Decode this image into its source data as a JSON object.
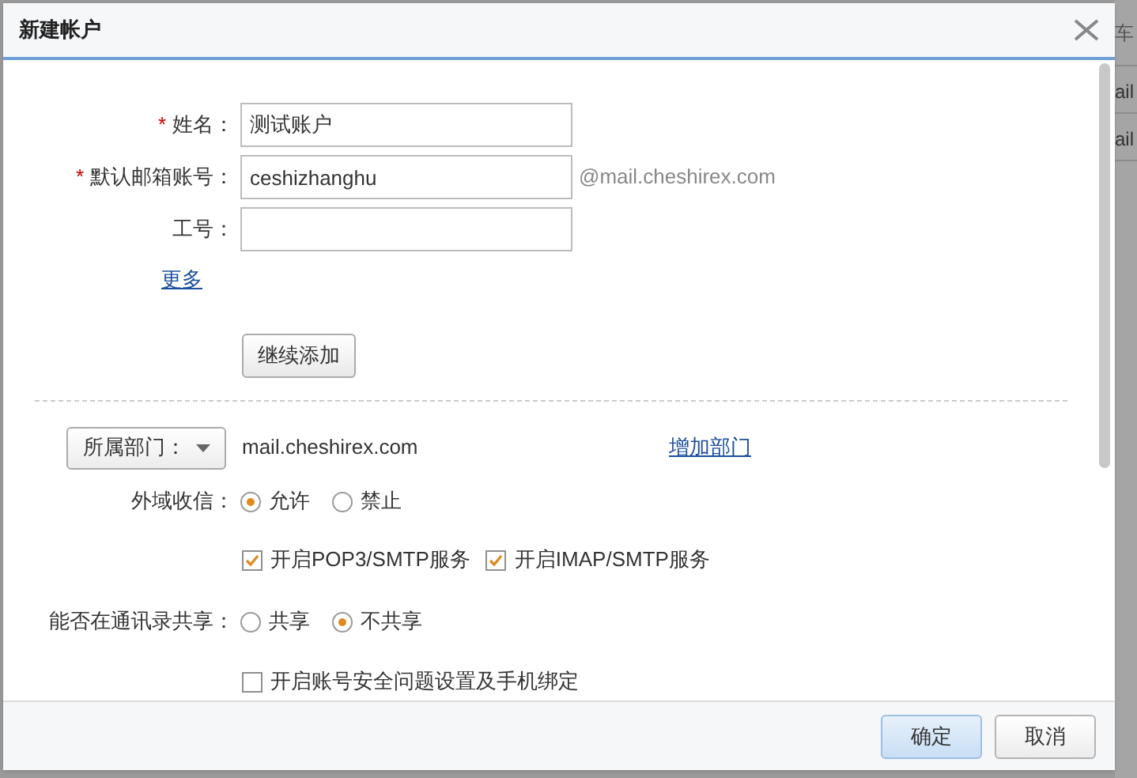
{
  "background": {
    "header_fragment": "车",
    "row_fragments": [
      "ail",
      "ail"
    ]
  },
  "dialog": {
    "title": "新建帐户",
    "fields": [
      {
        "label": "姓名：",
        "required_mark": "*",
        "value": "测试账户"
      },
      {
        "label": "默认邮箱账号：",
        "required_mark": "*",
        "value": "ceshizhanghu",
        "suffix": "@mail.cheshirex.com"
      },
      {
        "label": "工号："
      }
    ],
    "more_link": "更多",
    "continue_button": "继续添加",
    "department": {
      "dropdown": "所属部门：",
      "value": "mail.cheshirex.com",
      "add_link": "增加部门"
    },
    "external_mail": {
      "label": "外域收信：",
      "options": [
        {
          "label": "允许",
          "selected": true
        },
        {
          "label": "禁止",
          "selected": false
        }
      ]
    },
    "services": [
      {
        "label": "开启POP3/SMTP服务",
        "checked": true
      },
      {
        "label": "开启IMAP/SMTP服务",
        "checked": true
      }
    ],
    "address_book": {
      "label": "能否在通讯录共享：",
      "options": [
        {
          "label": "共享",
          "selected": false
        },
        {
          "label": "不共享",
          "selected": true
        }
      ]
    },
    "security": {
      "label": "开启账号安全问题设置及手机绑定",
      "checked": false
    },
    "buttons": [
      {
        "label": "确定",
        "primary": true
      },
      {
        "label": "取消",
        "primary": false
      }
    ]
  }
}
